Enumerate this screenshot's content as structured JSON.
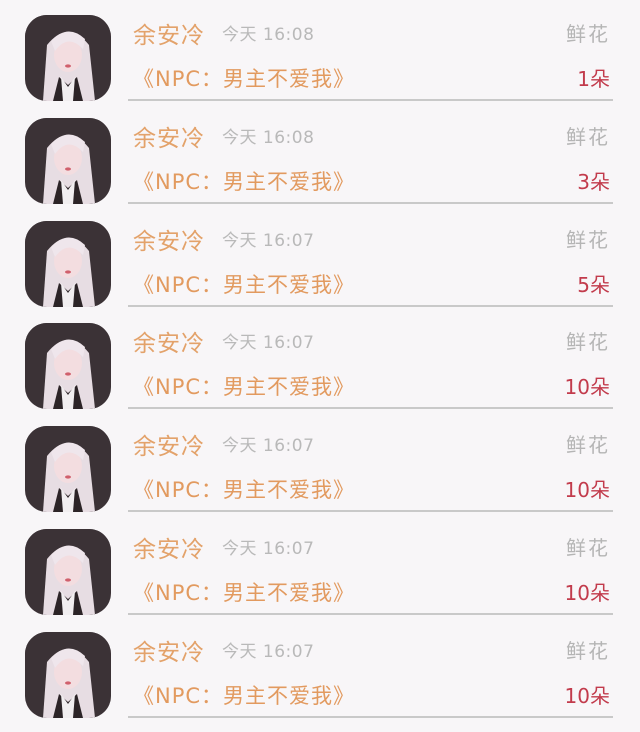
{
  "gifts": [
    {
      "sender": "余安冷",
      "time": "今天 16:08",
      "gift_type": "鲜花",
      "book": "《NPC：男主不爱我》",
      "count": "1朵"
    },
    {
      "sender": "余安冷",
      "time": "今天 16:08",
      "gift_type": "鲜花",
      "book": "《NPC：男主不爱我》",
      "count": "3朵"
    },
    {
      "sender": "余安冷",
      "time": "今天 16:07",
      "gift_type": "鲜花",
      "book": "《NPC：男主不爱我》",
      "count": "5朵"
    },
    {
      "sender": "余安冷",
      "time": "今天 16:07",
      "gift_type": "鲜花",
      "book": "《NPC：男主不爱我》",
      "count": "10朵"
    },
    {
      "sender": "余安冷",
      "time": "今天 16:07",
      "gift_type": "鲜花",
      "book": "《NPC：男主不爱我》",
      "count": "10朵"
    },
    {
      "sender": "余安冷",
      "time": "今天 16:07",
      "gift_type": "鲜花",
      "book": "《NPC：男主不爱我》",
      "count": "10朵"
    },
    {
      "sender": "余安冷",
      "time": "今天 16:07",
      "gift_type": "鲜花",
      "book": "《NPC：男主不爱我》",
      "count": "10朵"
    }
  ],
  "colors": {
    "sender": "#e3a26a",
    "book": "#e29a5f",
    "count": "#c23b4c",
    "muted": "#b9b9b9",
    "divider": "#c9c9c9"
  }
}
